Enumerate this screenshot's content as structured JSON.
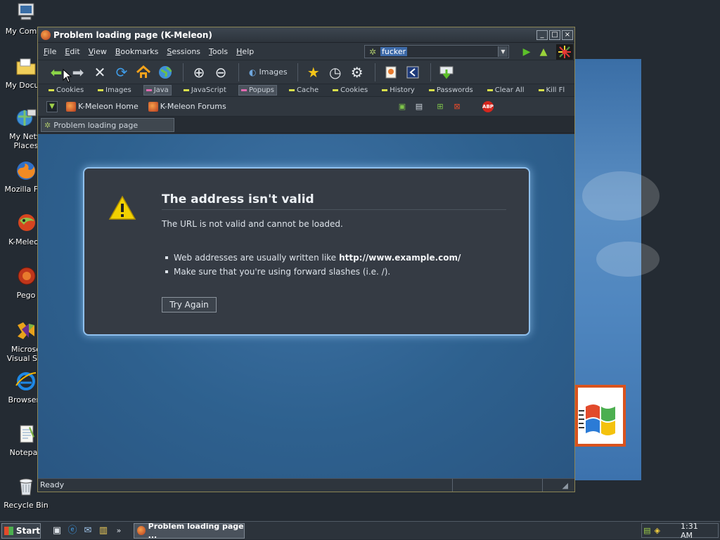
{
  "desktop": {
    "icons": [
      {
        "label": "My Compu"
      },
      {
        "label": "My Docum"
      },
      {
        "label": "My Netw"
      },
      {
        "label": "Places"
      },
      {
        "label": "Mozilla Fire"
      },
      {
        "label": "K-Meleon"
      },
      {
        "label": "Pego"
      },
      {
        "label": "Microso"
      },
      {
        "label": "Visual Stu"
      },
      {
        "label": "Browserv"
      },
      {
        "label": "Notepad"
      },
      {
        "label": "Recycle Bin"
      }
    ]
  },
  "window": {
    "title": "Problem loading page (K-Meleon)",
    "controls": {
      "minimize": "_",
      "maximize": "□",
      "close": "×"
    }
  },
  "menu": {
    "items": [
      "File",
      "Edit",
      "View",
      "Bookmarks",
      "Sessions",
      "Tools",
      "Help"
    ]
  },
  "urlbar": {
    "value": "fucker"
  },
  "toolbar": {
    "images_label": "Images"
  },
  "privacy": {
    "items": [
      {
        "label": "Cookies",
        "on": false
      },
      {
        "label": "Images",
        "on": false
      },
      {
        "label": "Java",
        "on": true
      },
      {
        "label": "JavaScript",
        "on": false
      },
      {
        "label": "Popups",
        "on": true
      },
      {
        "label": "Cache",
        "on": false
      },
      {
        "label": "Cookies",
        "on": false
      },
      {
        "label": "History",
        "on": false
      },
      {
        "label": "Passwords",
        "on": false
      },
      {
        "label": "Clear All",
        "on": false
      },
      {
        "label": "Kill Fl",
        "on": false
      }
    ]
  },
  "bookmarks": {
    "items": [
      "K-Meleon Home",
      "K-Meleon Forums"
    ],
    "abp_label": "ABP"
  },
  "tab": {
    "label": "Problem loading page"
  },
  "error": {
    "title": "The address isn't valid",
    "subtitle": "The URL is not valid and cannot be loaded.",
    "bullet1_text": "Web addresses are usually written like",
    "bullet1_example": "http://www.example.com/",
    "bullet2_text": "Make sure that you're using forward slashes (i.e. /).",
    "button": "Try Again"
  },
  "status": {
    "text": "Ready"
  },
  "taskbar": {
    "start_label": "Start",
    "more": "»",
    "task_label": "Problem loading page ...",
    "clock": "1:31 AM"
  },
  "colors": {
    "content_bg": "#2e618f",
    "error_panel": "#353b44",
    "error_glow": "#8fc0ee",
    "warning_yellow": "#f2d100"
  }
}
